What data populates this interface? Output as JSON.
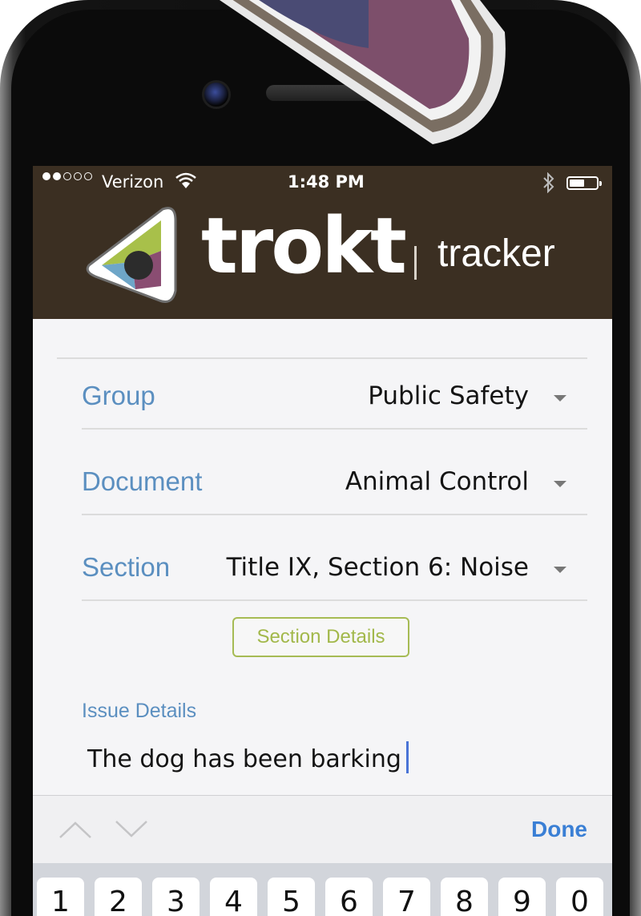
{
  "status_bar": {
    "carrier": "Verizon",
    "time": "1:48 PM",
    "signal_bars_filled": 2,
    "signal_bars_total": 5
  },
  "header": {
    "brand": "trokt",
    "product": "tracker",
    "background": "#3b2f22"
  },
  "form": {
    "fields": [
      {
        "label": "Group",
        "value": "Public Safety"
      },
      {
        "label": "Document",
        "value": "Animal Control"
      },
      {
        "label": "Section",
        "value": "Title IX, Section 6: Noise"
      }
    ],
    "section_details_button": "Section Details",
    "issue_label": "Issue Details",
    "issue_text": "The dog has been barking"
  },
  "keyboard_bar": {
    "done_label": "Done"
  },
  "keyboard": {
    "keys": [
      "1",
      "2",
      "3",
      "4",
      "5",
      "6",
      "7",
      "8",
      "9",
      "0"
    ]
  },
  "colors": {
    "label_blue": "#5b8fc0",
    "accent_green": "#a6bb54",
    "done_blue": "#3a7fd5"
  }
}
